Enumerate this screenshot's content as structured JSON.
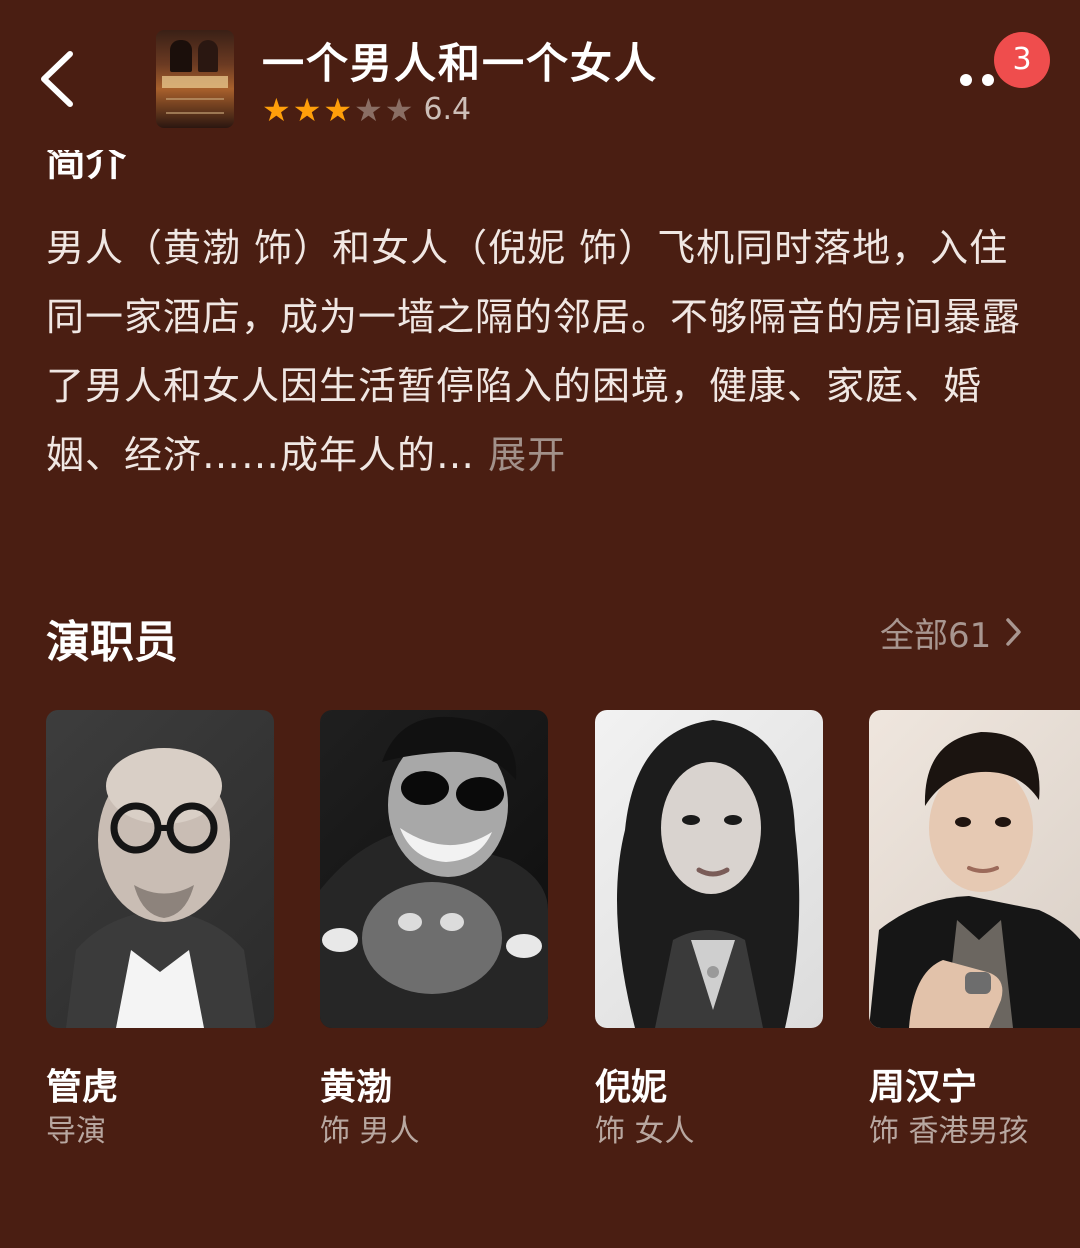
{
  "header": {
    "title": "一个男人和一个女人",
    "rating": {
      "stars_filled": 3,
      "stars_total": 5,
      "score": "6.4"
    },
    "notification_count": "3",
    "icons": {
      "back": "chevron-left-icon",
      "more": "more-dots-icon"
    }
  },
  "intro": {
    "heading": "简介",
    "text": "男人（黄渤 饰）和女人（倪妮 饰）飞机同时落地，入住同一家酒店，成为一墙之隔的邻居。不够隔音的房间暴露了男人和女人因生活暂停陷入的困境，健康、家庭、婚姻、经济……成年人的…",
    "expand_label": "展开"
  },
  "cast": {
    "heading": "演职员",
    "all_label": "全部61",
    "members": [
      {
        "name": "管虎",
        "role": "导演"
      },
      {
        "name": "黄渤",
        "role": "饰 男人"
      },
      {
        "name": "倪妮",
        "role": "饰 女人"
      },
      {
        "name": "周汉宁",
        "role": "饰 香港男孩"
      }
    ]
  },
  "colors": {
    "background": "#4a1e12",
    "star_active": "#ff9f0a",
    "badge": "#ef4d4d",
    "secondary_text": "#a89690"
  }
}
